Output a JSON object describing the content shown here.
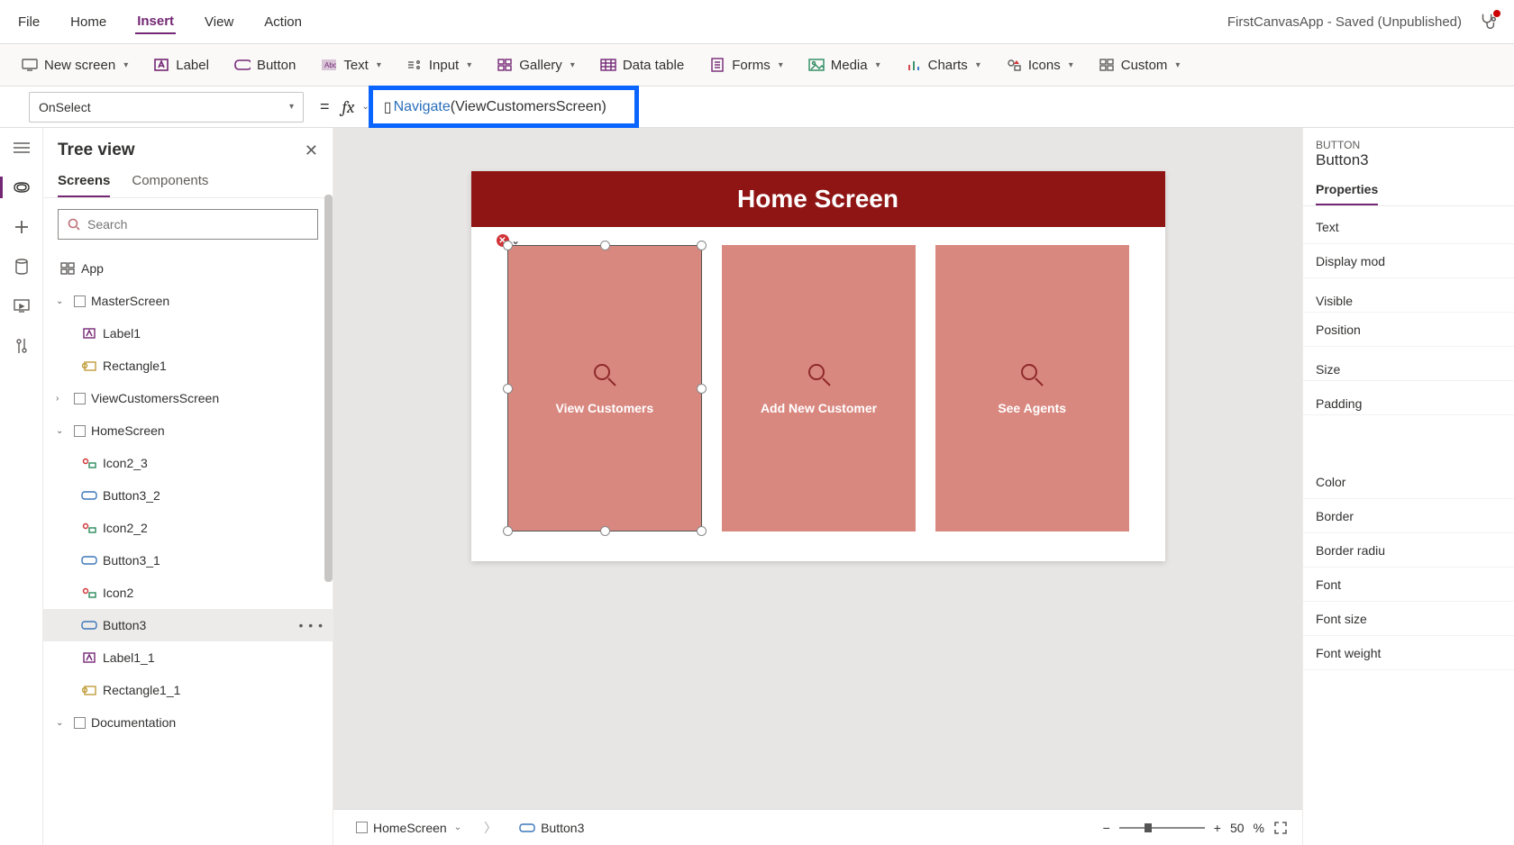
{
  "app_title": "FirstCanvasApp - Saved (Unpublished)",
  "menubar": [
    "File",
    "Home",
    "Insert",
    "View",
    "Action"
  ],
  "menubar_active": "Insert",
  "ribbon": {
    "new_screen": "New screen",
    "label": "Label",
    "button": "Button",
    "text": "Text",
    "input": "Input",
    "gallery": "Gallery",
    "data_table": "Data table",
    "forms": "Forms",
    "media": "Media",
    "charts": "Charts",
    "icons": "Icons",
    "custom": "Custom"
  },
  "formula": {
    "property": "OnSelect",
    "fx": "fx",
    "fn": "Navigate",
    "open": "(",
    "arg": "ViewCustomersScreen",
    "close": ")"
  },
  "tree": {
    "title": "Tree view",
    "tabs": {
      "screens": "Screens",
      "components": "Components"
    },
    "search_placeholder": "Search",
    "items": {
      "app": "App",
      "master": "MasterScreen",
      "label1": "Label1",
      "rect1": "Rectangle1",
      "viewcust": "ViewCustomersScreen",
      "home": "HomeScreen",
      "icon2_3": "Icon2_3",
      "btn3_2": "Button3_2",
      "icon2_2": "Icon2_2",
      "btn3_1": "Button3_1",
      "icon2": "Icon2",
      "btn3": "Button3",
      "label1_1": "Label1_1",
      "rect1_1": "Rectangle1_1",
      "doc": "Documentation"
    }
  },
  "screen": {
    "title": "Home Screen",
    "cards": [
      "View Customers",
      "Add New Customer",
      "See Agents"
    ]
  },
  "breadcrumb": {
    "screen": "HomeScreen",
    "control": "Button3"
  },
  "zoom": {
    "value": "50",
    "pct": "%"
  },
  "props": {
    "kind": "BUTTON",
    "name": "Button3",
    "tab": "Properties",
    "rows": [
      "Text",
      "Display mod",
      "Visible",
      "Position",
      "Size",
      "Padding",
      "Color",
      "Border",
      "Border radiu",
      "Font",
      "Font size",
      "Font weight"
    ]
  }
}
